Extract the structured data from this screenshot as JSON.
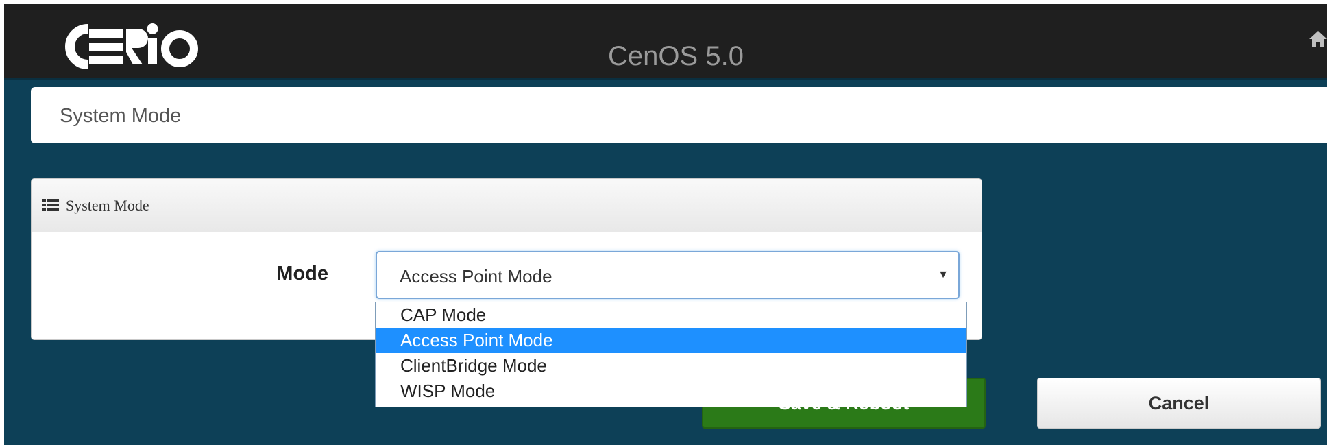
{
  "header": {
    "logo_text": "CERIO",
    "app_title": "CenOS 5.0",
    "home_icon": "home-icon"
  },
  "breadcrumb": {
    "title": "System Mode"
  },
  "panel": {
    "title": "System Mode",
    "icon": "list-icon",
    "mode_label": "Mode",
    "mode_select": {
      "value": "Access Point Mode",
      "options": [
        "CAP Mode",
        "Access Point Mode",
        "ClientBridge Mode",
        "WISP Mode"
      ],
      "selected_index": 1
    }
  },
  "buttons": {
    "save_label": "Save & Reboot",
    "cancel_label": "Cancel"
  },
  "colors": {
    "background": "#0d4057",
    "topbar": "#1f1f1f",
    "save_button": "#2b7a18",
    "selected_option": "#1e90ff"
  }
}
